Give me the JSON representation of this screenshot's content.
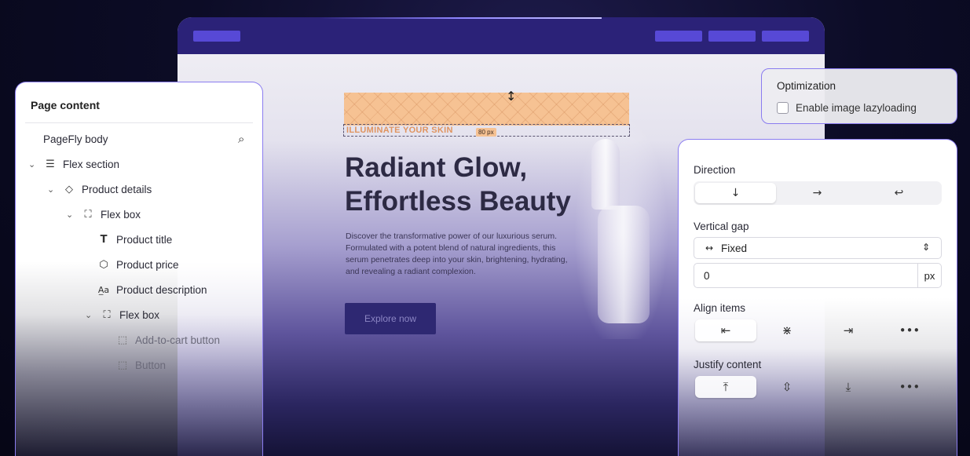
{
  "preview": {
    "eyebrow": "ILLUMINATE YOUR SKIN",
    "spacing_badge": "80 px",
    "title": "Radiant Glow, Effortless Beauty",
    "description": "Discover the transformative power of our luxurious serum. Formulated with a potent blend of natural ingredients, this serum penetrates deep into your skin, brightening, hydrating, and revealing a radiant complexion.",
    "cta_label": "Explore now"
  },
  "page_content": {
    "title": "Page content",
    "tree": [
      {
        "label": "PageFly body",
        "icon": "none"
      },
      {
        "label": "Flex section",
        "icon": "section-icon"
      },
      {
        "label": "Product details",
        "icon": "tag-icon"
      },
      {
        "label": "Flex box",
        "icon": "flex-box-icon"
      },
      {
        "label": "Product title",
        "icon": "text-icon"
      },
      {
        "label": "Product price",
        "icon": "price-tag-icon"
      },
      {
        "label": "Product description",
        "icon": "description-icon"
      },
      {
        "label": "Flex box",
        "icon": "flex-box-icon"
      },
      {
        "label": "Add-to-cart button",
        "icon": "button-icon"
      },
      {
        "label": "Button",
        "icon": "button-icon"
      }
    ]
  },
  "optimization": {
    "title": "Optimization",
    "lazyload_label": "Enable image lazyloading",
    "lazyload_checked": false
  },
  "layout_settings": {
    "direction_label": "Direction",
    "direction_options": [
      "vertical-arrow-icon",
      "horizontal-arrow-icon",
      "wrap-arrow-icon"
    ],
    "direction_selected": 0,
    "vertical_gap_label": "Vertical gap",
    "gap_mode": "Fixed",
    "gap_value": "0",
    "gap_unit": "px",
    "align_items_label": "Align items",
    "align_items_selected": 0,
    "justify_content_label": "Justify content",
    "justify_content_selected": 0
  },
  "colors": {
    "accent": "#8a7cf0",
    "browser_bar": "#2b2278",
    "nav_pill": "#5749d6",
    "cta": "#2e2872",
    "eyebrow": "#e0945f",
    "spacing_fill": "#f6c293"
  }
}
